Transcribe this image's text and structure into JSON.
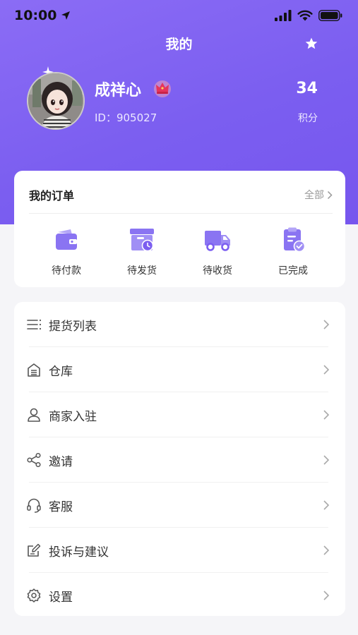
{
  "status_bar": {
    "time": "10:00"
  },
  "header": {
    "title": "我的"
  },
  "profile": {
    "name": "成祥心",
    "id_text": "ID：905027",
    "points_value": "34",
    "points_label": "积分"
  },
  "orders": {
    "title": "我的订单",
    "all_label": "全部",
    "items": [
      {
        "label": "待付款",
        "icon": "wallet-icon"
      },
      {
        "label": "待发货",
        "icon": "box-clock-icon"
      },
      {
        "label": "待收货",
        "icon": "truck-icon"
      },
      {
        "label": "已完成",
        "icon": "clipboard-check-icon"
      }
    ]
  },
  "menu": {
    "items": [
      {
        "label": "提货列表",
        "icon": "list-icon"
      },
      {
        "label": "仓库",
        "icon": "warehouse-icon"
      },
      {
        "label": "商家入驻",
        "icon": "user-icon"
      },
      {
        "label": "邀请",
        "icon": "share-icon"
      },
      {
        "label": "客服",
        "icon": "headset-icon"
      },
      {
        "label": "投诉与建议",
        "icon": "edit-icon"
      },
      {
        "label": "设置",
        "icon": "gear-icon"
      }
    ]
  },
  "colors": {
    "accent": "#7b5ef0",
    "icon_purple": "#8a74f2",
    "background": "#f5f5f8"
  }
}
